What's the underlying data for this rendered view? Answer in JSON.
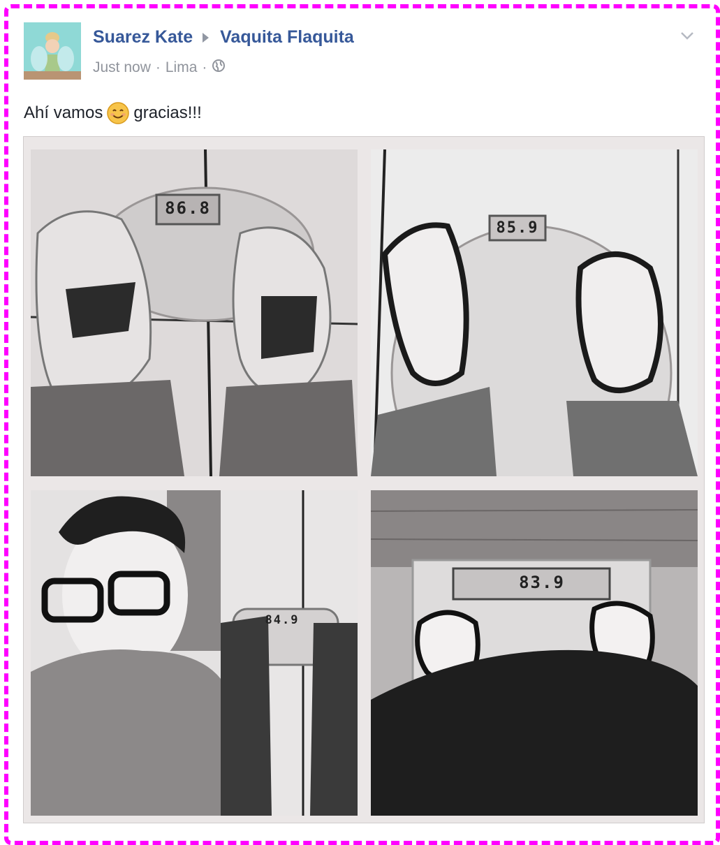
{
  "post": {
    "author": "Suarez Kate",
    "group": "Vaquita Flaquita",
    "time": "Just now",
    "location": "Lima",
    "message_before": "Ahí vamos",
    "message_after": "gracias!!!"
  },
  "icons": {
    "arrow": "right-triangle-icon",
    "privacy": "globe-icon",
    "menu": "chevron-down-icon",
    "emoji": "smiling-face-icon"
  },
  "photos": [
    {
      "name": "photo-sneakers-scale",
      "reading": "86.8"
    },
    {
      "name": "photo-flipflops-scale",
      "reading": "85.9"
    },
    {
      "name": "photo-selfie-and-scale",
      "reading": "84.9"
    },
    {
      "name": "photo-flipflops-scale-2",
      "reading": "83.9"
    }
  ],
  "colors": {
    "frame": "#ff00ff",
    "link": "#365899",
    "meta": "#90949c",
    "text": "#1d2129"
  }
}
